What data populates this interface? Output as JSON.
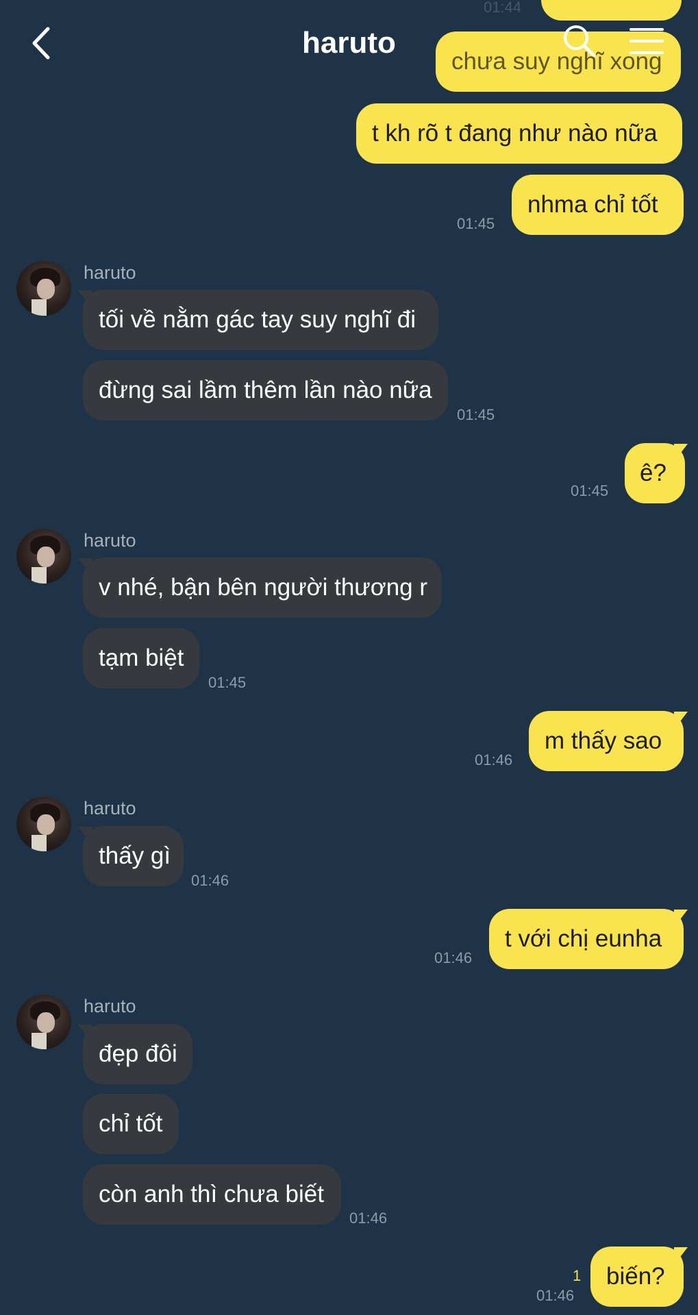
{
  "header": {
    "title": "haruto",
    "back_icon": "chevron-left-icon",
    "search_icon": "search-icon",
    "menu_icon": "hamburger-menu-icon"
  },
  "colors": {
    "background": "#1e3347",
    "outgoing_bubble": "#f9e34f",
    "incoming_bubble": "#363a3f",
    "timestamp": "#8f9ba6"
  },
  "messages": {
    "m0": {
      "text": "",
      "time": "01:44"
    },
    "m1": {
      "text": "chưa suy nghĩ xong"
    },
    "m2": {
      "text": "t kh rõ t đang như nào nữa"
    },
    "m3": {
      "text": "nhma chỉ tốt",
      "time": "01:45"
    },
    "g1": {
      "sender": "haruto"
    },
    "m4": {
      "text": "tối về nằm gác tay suy nghĩ đi"
    },
    "m5": {
      "text": "đừng sai lầm thêm lần nào nữa",
      "time": "01:45"
    },
    "m6": {
      "text": "ê?",
      "time": "01:45"
    },
    "g2": {
      "sender": "haruto"
    },
    "m7": {
      "text": "v nhé, bận bên người thương r"
    },
    "m8": {
      "text": "tạm biệt",
      "time": "01:45"
    },
    "m9": {
      "text": "m thấy sao",
      "time": "01:46"
    },
    "g3": {
      "sender": "haruto"
    },
    "m10": {
      "text": "thấy gì",
      "time": "01:46"
    },
    "m11": {
      "text": "t với chị eunha",
      "time": "01:46"
    },
    "g4": {
      "sender": "haruto"
    },
    "m12": {
      "text": "đẹp đôi"
    },
    "m13": {
      "text": "chỉ tốt"
    },
    "m14": {
      "text": "còn anh thì chưa biết",
      "time": "01:46"
    },
    "m15": {
      "text": "biến?",
      "time": "01:46",
      "unread": "1"
    }
  }
}
